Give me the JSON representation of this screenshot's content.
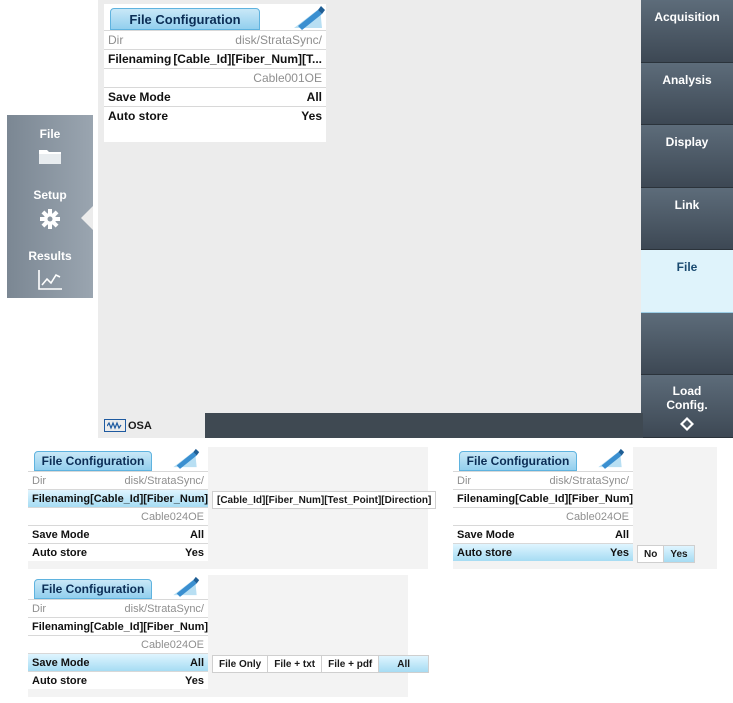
{
  "main": {
    "softkeys": [
      "Acquisition",
      "Analysis",
      "Display",
      "Link",
      "File",
      ""
    ],
    "softkey_active": "File",
    "load_config": [
      "Load",
      "Config."
    ],
    "nav": [
      {
        "label": "File",
        "icon": "folder-icon"
      },
      {
        "label": "Setup",
        "icon": "gear-icon"
      },
      {
        "label": "Results",
        "icon": "chart-icon"
      }
    ],
    "status_label": "OSA",
    "panel": {
      "title": "File Configuration",
      "dir_label": "Dir",
      "dir_value": "disk/StrataSync/",
      "filenaming_label": "Filenaming",
      "filenaming_value": "[Cable_Id][Fiber_Num][T...",
      "filename": "Cable001OE",
      "save_mode_label": "Save Mode",
      "save_mode_value": "All",
      "auto_store_label": "Auto store",
      "auto_store_value": "Yes"
    }
  },
  "panel_a": {
    "title": "File Configuration",
    "dir_label": "Dir",
    "dir_value": "disk/StrataSync/",
    "filenaming_label": "Filenaming",
    "filenaming_value": "[Cable_Id][Fiber_Num][T...",
    "filename": "Cable024OE",
    "save_mode_label": "Save Mode",
    "save_mode_value": "All",
    "auto_store_label": "Auto store",
    "auto_store_value": "Yes",
    "popup": "[Cable_Id][Fiber_Num][Test_Point][Direction]"
  },
  "panel_b": {
    "title": "File Configuration",
    "dir_label": "Dir",
    "dir_value": "disk/StrataSync/",
    "filenaming_label": "Filenaming",
    "filenaming_value": "[Cable_Id][Fiber_Num][T...",
    "filename": "Cable024OE",
    "save_mode_label": "Save Mode",
    "save_mode_value": "All",
    "auto_store_label": "Auto store",
    "auto_store_value": "Yes",
    "options": [
      "No",
      "Yes"
    ],
    "selected_option": "Yes"
  },
  "panel_c": {
    "title": "File Configuration",
    "dir_label": "Dir",
    "dir_value": "disk/StrataSync/",
    "filenaming_label": "Filenaming",
    "filenaming_value": "[Cable_Id][Fiber_Num][T...",
    "filename": "Cable024OE",
    "save_mode_label": "Save Mode",
    "save_mode_value": "All",
    "auto_store_label": "Auto store",
    "auto_store_value": "Yes",
    "options": [
      "File Only",
      "File + txt",
      "File + pdf",
      "All"
    ],
    "selected_option": "All"
  },
  "colors": {
    "softkey": "#4b5763",
    "active_softkey": "#dff3fb",
    "highlight": "#a6dcf3",
    "tab_border": "#5fb3df",
    "status_dark": "#3f4952"
  }
}
